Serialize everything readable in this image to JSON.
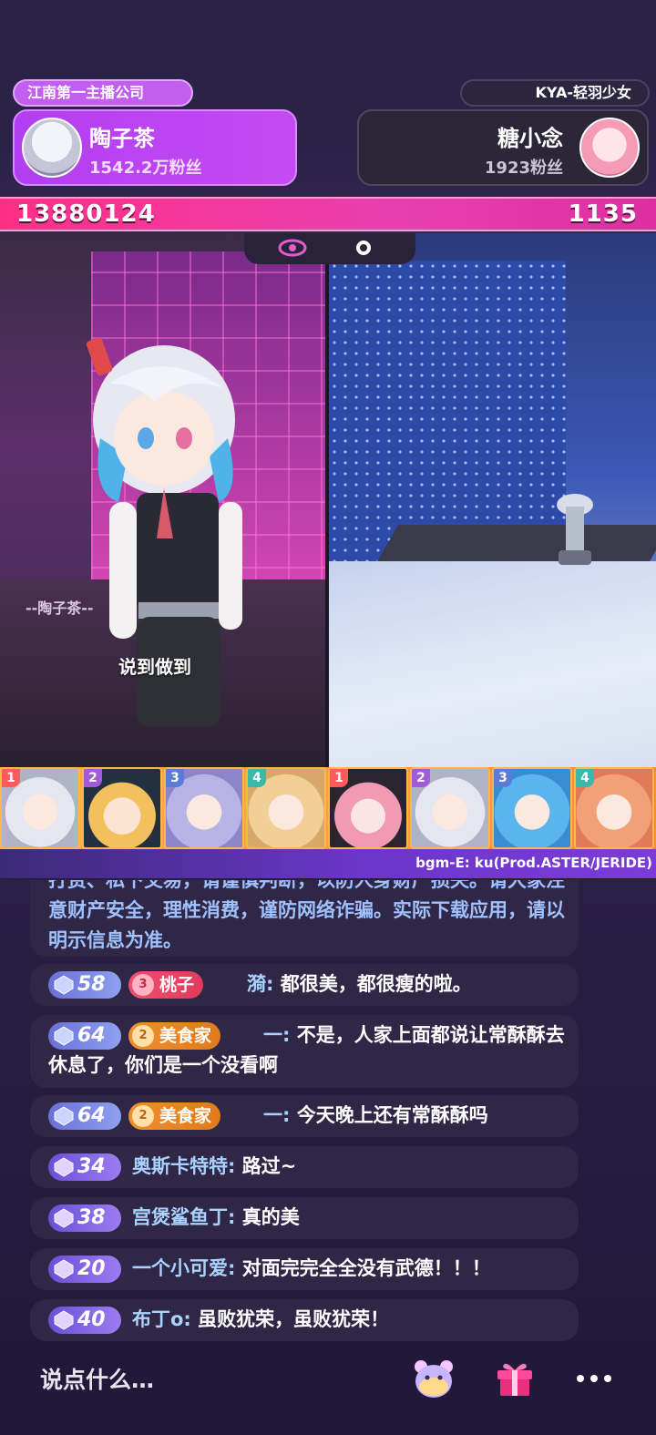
{
  "header": {
    "agency": "江南第一主播公司",
    "opponent_tag": "KYA-轻羽少女",
    "host": {
      "name": "陶子茶",
      "fans": "1542.2万粉丝"
    },
    "opponent": {
      "name": "糖小念",
      "fans": "1923粉丝"
    }
  },
  "pk": {
    "left_score": "13880124",
    "right_score": "1135"
  },
  "video": {
    "caption_name": "--陶子茶--",
    "lyric": "说到做到"
  },
  "ranks": [
    "1",
    "2",
    "3",
    "4",
    "1",
    "2",
    "3",
    "4"
  ],
  "bgm": "bgm-E: ku(Prod.ASTER/JERIDE)",
  "notice": {
    "text": "打赏、私下交易，请谨慎判断，以防人身财产损失。请大家注意财产安全，理性消费，谨防网络诈骗。实际下载应用，请以明示信息为准。"
  },
  "messages": [
    {
      "level": "58",
      "badge": "桃子",
      "badge_level": "3",
      "user": "漪:",
      "text": "都很美，都很瘦的啦。"
    },
    {
      "level": "64",
      "badge": "美食家",
      "badge_level": "2",
      "user": "一:",
      "text": "不是，人家上面都说让常酥酥去休息了，你们是一个没看啊"
    },
    {
      "level": "64",
      "badge": "美食家",
      "badge_level": "2",
      "user": "一:",
      "text": "今天晚上还有常酥酥吗"
    },
    {
      "level": "34",
      "user": "奥斯卡特特:",
      "text": "路过~"
    },
    {
      "level": "38",
      "user": "宫煲鲨鱼丁:",
      "text": "真的美"
    },
    {
      "level": "20",
      "user": "一个小可爱:",
      "text": "对面完完全全没有武德！！！"
    },
    {
      "level": "40",
      "user": "布丁o:",
      "text": "虽败犹荣，虽败犹荣！"
    }
  ],
  "input": {
    "placeholder": "说点什么…"
  },
  "colors": {
    "accent": "#c54af2",
    "score_bar": "#ff2f86",
    "user_name": "#a9d2ff"
  }
}
